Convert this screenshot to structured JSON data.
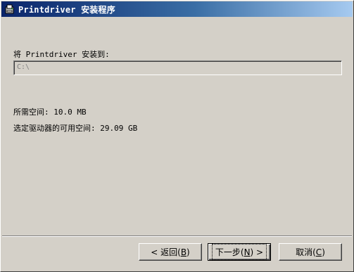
{
  "window": {
    "title": "Printdriver 安装程序",
    "icon": "installer-app-icon"
  },
  "install": {
    "dest_label": "将 Printdriver 安装到:",
    "dest_path": "C:\\"
  },
  "space": {
    "required": "所需空间: 10.0 MB",
    "available": "选定驱动器的可用空间: 29.09 GB"
  },
  "buttons": {
    "back": {
      "prefix": "< 返回(",
      "mnemonic": "B",
      "suffix": ")"
    },
    "next": {
      "prefix": "下一步(",
      "mnemonic": "N",
      "suffix": ") >"
    },
    "cancel": {
      "prefix": "取消(",
      "mnemonic": "C",
      "suffix": ")"
    }
  },
  "colors": {
    "titlebar_start": "#0a246a",
    "titlebar_end": "#a6caf0",
    "face": "#d4d0c8"
  }
}
